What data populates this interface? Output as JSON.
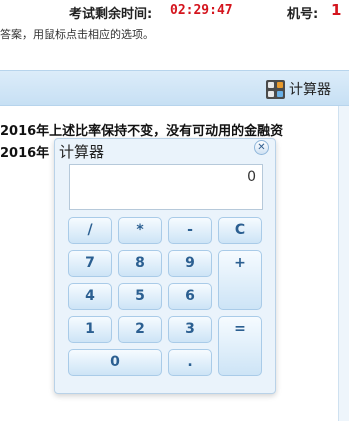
{
  "header": {
    "timer_label": "考试剩余时间:",
    "timer_value": "02:29:47",
    "seat_label": "机号:",
    "seat_value": "1"
  },
  "instruction": "答案，用鼠标点击相应的选项。",
  "toolbar": {
    "calculator_label": "计算器",
    "calculator_icon": "calculator-icon"
  },
  "question": {
    "line1": "2016年上述比率保持不变，没有可动用的金融资",
    "line2": "2016年"
  },
  "calculator": {
    "title": "计算器",
    "close_icon": "close-icon",
    "display": "0",
    "keys": {
      "slash": "/",
      "star": "*",
      "minus": "-",
      "clear": "C",
      "seven": "7",
      "eight": "8",
      "nine": "9",
      "plus": "+",
      "four": "4",
      "five": "5",
      "six": "6",
      "one": "1",
      "two": "2",
      "three": "3",
      "equals": "=",
      "zero": "0",
      "dot": "."
    }
  },
  "colors": {
    "accent_red": "#d4141d",
    "toolbar_blue": "#c7e0f4",
    "key_text": "#2b5f91"
  }
}
